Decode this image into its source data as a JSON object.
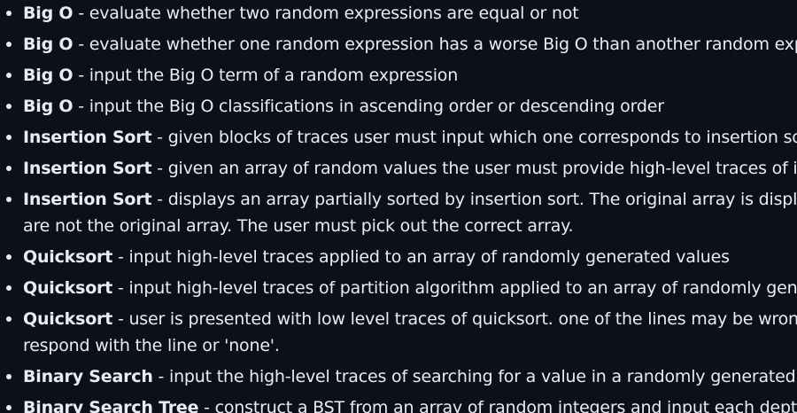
{
  "items": [
    {
      "term": "Big O",
      "sep": " - ",
      "desc": "evaluate whether two random expressions are equal or not",
      "desc2": ""
    },
    {
      "term": "Big O",
      "sep": " - ",
      "desc": "evaluate whether one random expression has a worse Big O than another random expressio",
      "desc2": ""
    },
    {
      "term": "Big O",
      "sep": " - ",
      "desc": "input the Big O term of a random expression",
      "desc2": ""
    },
    {
      "term": "Big O",
      "sep": " - ",
      "desc": "input the Big O classifications in ascending order or descending order",
      "desc2": ""
    },
    {
      "term": "Insertion Sort",
      "sep": " - ",
      "desc": "given blocks of traces user must input which one corresponds to insertion sort",
      "desc2": ""
    },
    {
      "term": "Insertion Sort",
      "sep": " - ",
      "desc": "given an array of random values the user must provide high-level traces of insertion",
      "desc2": ""
    },
    {
      "term": "Insertion Sort",
      "sep": " - ",
      "desc": "displays an array partially sorted by insertion sort. The original array is display with c",
      "desc2": "are not the original array. The user must pick out the correct array."
    },
    {
      "term": "Quicksort",
      "sep": " - ",
      "desc": "input high-level traces applied to an array of randomly generated values",
      "desc2": ""
    },
    {
      "term": "Quicksort",
      "sep": " - ",
      "desc": "input high-level traces of partition algorithm applied to an array of randomly generated",
      "desc2": ""
    },
    {
      "term": "Quicksort",
      "sep": " - ",
      "desc": "user is presented with low level traces of quicksort. one of the lines may be wrong the u",
      "desc2": "respond with the line or 'none'."
    },
    {
      "term": "Binary Search",
      "sep": " - ",
      "desc": "input the high-level traces of searching for a value in a randomly generated array",
      "desc2": ""
    },
    {
      "term": "Binary Search Tree",
      "sep": " - ",
      "desc": "construct a BST from an array of random integers and input each depth",
      "desc2": ""
    }
  ]
}
